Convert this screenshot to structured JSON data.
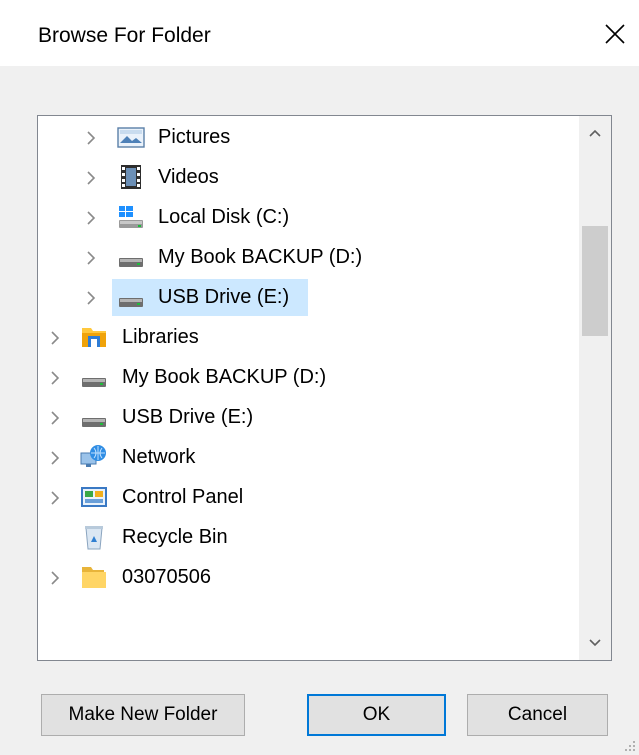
{
  "window": {
    "title": "Browse For Folder",
    "close_glyph": "✕"
  },
  "tree": {
    "items": [
      {
        "label": "Pictures",
        "icon": "pictures-icon",
        "expandable": true,
        "level": 1,
        "selected": false
      },
      {
        "label": "Videos",
        "icon": "videos-icon",
        "expandable": true,
        "level": 1,
        "selected": false
      },
      {
        "label": "Local Disk (C:)",
        "icon": "windows-drive-icon",
        "expandable": true,
        "level": 1,
        "selected": false
      },
      {
        "label": "My Book BACKUP (D:)",
        "icon": "drive-icon",
        "expandable": true,
        "level": 1,
        "selected": false
      },
      {
        "label": "USB Drive (E:)",
        "icon": "drive-icon",
        "expandable": true,
        "level": 1,
        "selected": true
      },
      {
        "label": "Libraries",
        "icon": "libraries-icon",
        "expandable": true,
        "level": 0,
        "selected": false
      },
      {
        "label": "My Book BACKUP (D:)",
        "icon": "drive-icon",
        "expandable": true,
        "level": 0,
        "selected": false
      },
      {
        "label": "USB Drive (E:)",
        "icon": "drive-icon",
        "expandable": true,
        "level": 0,
        "selected": false
      },
      {
        "label": "Network",
        "icon": "network-icon",
        "expandable": true,
        "level": 0,
        "selected": false
      },
      {
        "label": "Control Panel",
        "icon": "control-panel-icon",
        "expandable": true,
        "level": 0,
        "selected": false
      },
      {
        "label": "Recycle Bin",
        "icon": "recycle-bin-icon",
        "expandable": false,
        "level": 0,
        "selected": false
      },
      {
        "label": "03070506",
        "icon": "folder-icon",
        "expandable": true,
        "level": 0,
        "selected": false
      }
    ]
  },
  "buttons": {
    "make_new_folder": "Make New Folder",
    "ok": "OK",
    "cancel": "Cancel"
  },
  "colors": {
    "selection": "#cce8ff",
    "default_button_border": "#0078d7",
    "scroll_thumb": "#cdcdcd"
  }
}
